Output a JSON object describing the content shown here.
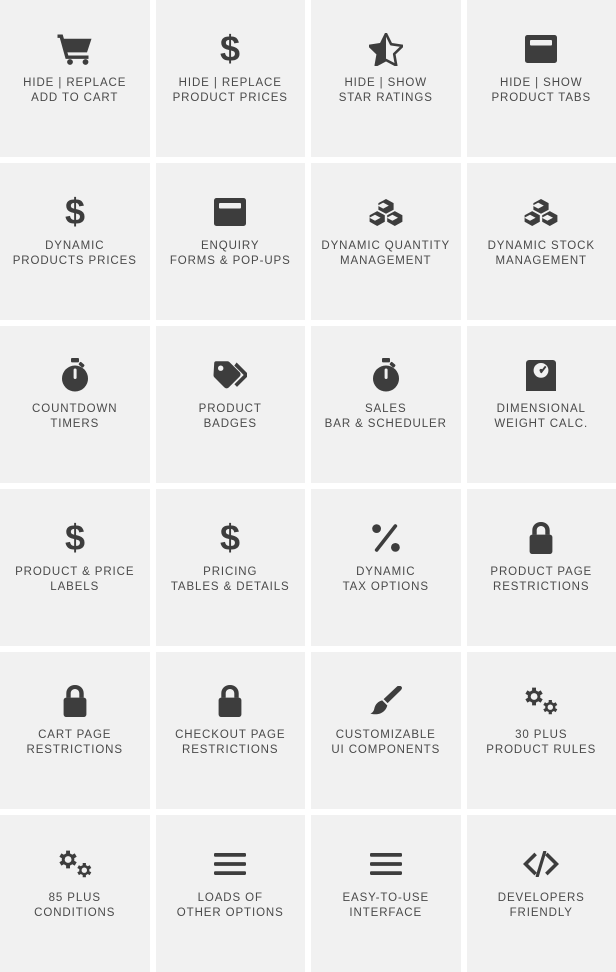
{
  "page": {
    "title": "Product Feature Grid",
    "background_color": "#ffffff",
    "card_background": "#f1f1f1",
    "icon_color": "#3d3d3d",
    "label_color": "#4a4a4a",
    "columns": 4,
    "rows": 6
  },
  "cards": [
    {
      "icon": "shopping-cart-icon",
      "line1": "HIDE | REPLACE",
      "line2": "ADD TO CART"
    },
    {
      "icon": "dollar-sign-icon",
      "line1": "HIDE | REPLACE",
      "line2": "PRODUCT PRICES"
    },
    {
      "icon": "half-star-icon",
      "line1": "HIDE | SHOW",
      "line2": "STAR RATINGS"
    },
    {
      "icon": "product-tabs-icon",
      "line1": "HIDE | SHOW",
      "line2": "PRODUCT TABS"
    },
    {
      "icon": "dollar-sign-icon",
      "line1": "DYNAMIC",
      "line2": "PRODUCTS PRICES"
    },
    {
      "icon": "enquiry-window-icon",
      "line1": "ENQUIRY",
      "line2": "FORMS & POP-UPS"
    },
    {
      "icon": "boxes-stack-icon",
      "line1": "DYNAMIC QUANTITY",
      "line2": "MANAGEMENT"
    },
    {
      "icon": "boxes-stack-icon",
      "line1": "DYNAMIC STOCK",
      "line2": "MANAGEMENT"
    },
    {
      "icon": "stopwatch-icon",
      "line1": "COUNTDOWN",
      "line2": "TIMERS"
    },
    {
      "icon": "tags-icon",
      "line1": "PRODUCT",
      "line2": "BADGES"
    },
    {
      "icon": "stopwatch-icon",
      "line1": "SALES",
      "line2": "BAR & SCHEDULER"
    },
    {
      "icon": "weight-scale-icon",
      "line1": "DIMENSIONAL",
      "line2": "WEIGHT CALC."
    },
    {
      "icon": "dollar-sign-icon",
      "line1": "PRODUCT & PRICE",
      "line2": "LABELS"
    },
    {
      "icon": "dollar-sign-icon",
      "line1": "PRICING",
      "line2": "TABLES & DETAILS"
    },
    {
      "icon": "percent-icon",
      "line1": "DYNAMIC",
      "line2": "TAX OPTIONS"
    },
    {
      "icon": "lock-icon",
      "line1": "PRODUCT PAGE",
      "line2": "RESTRICTIONS"
    },
    {
      "icon": "lock-icon",
      "line1": "CART PAGE",
      "line2": "RESTRICTIONS"
    },
    {
      "icon": "lock-icon",
      "line1": "CHECKOUT PAGE",
      "line2": "RESTRICTIONS"
    },
    {
      "icon": "paintbrush-icon",
      "line1": "CUSTOMIZABLE",
      "line2": "UI COMPONENTS"
    },
    {
      "icon": "cogs-icon",
      "line1": "30 PLUS",
      "line2": "PRODUCT RULES"
    },
    {
      "icon": "cogs-icon",
      "line1": "85 PLUS",
      "line2": "CONDITIONS"
    },
    {
      "icon": "hamburger-lines-icon",
      "line1": "LOADS OF",
      "line2": "OTHER OPTIONS"
    },
    {
      "icon": "hamburger-lines-icon",
      "line1": "EASY-TO-USE",
      "line2": "INTERFACE"
    },
    {
      "icon": "code-brackets-icon",
      "line1": "DEVELOPERS",
      "line2": "FRIENDLY"
    }
  ]
}
